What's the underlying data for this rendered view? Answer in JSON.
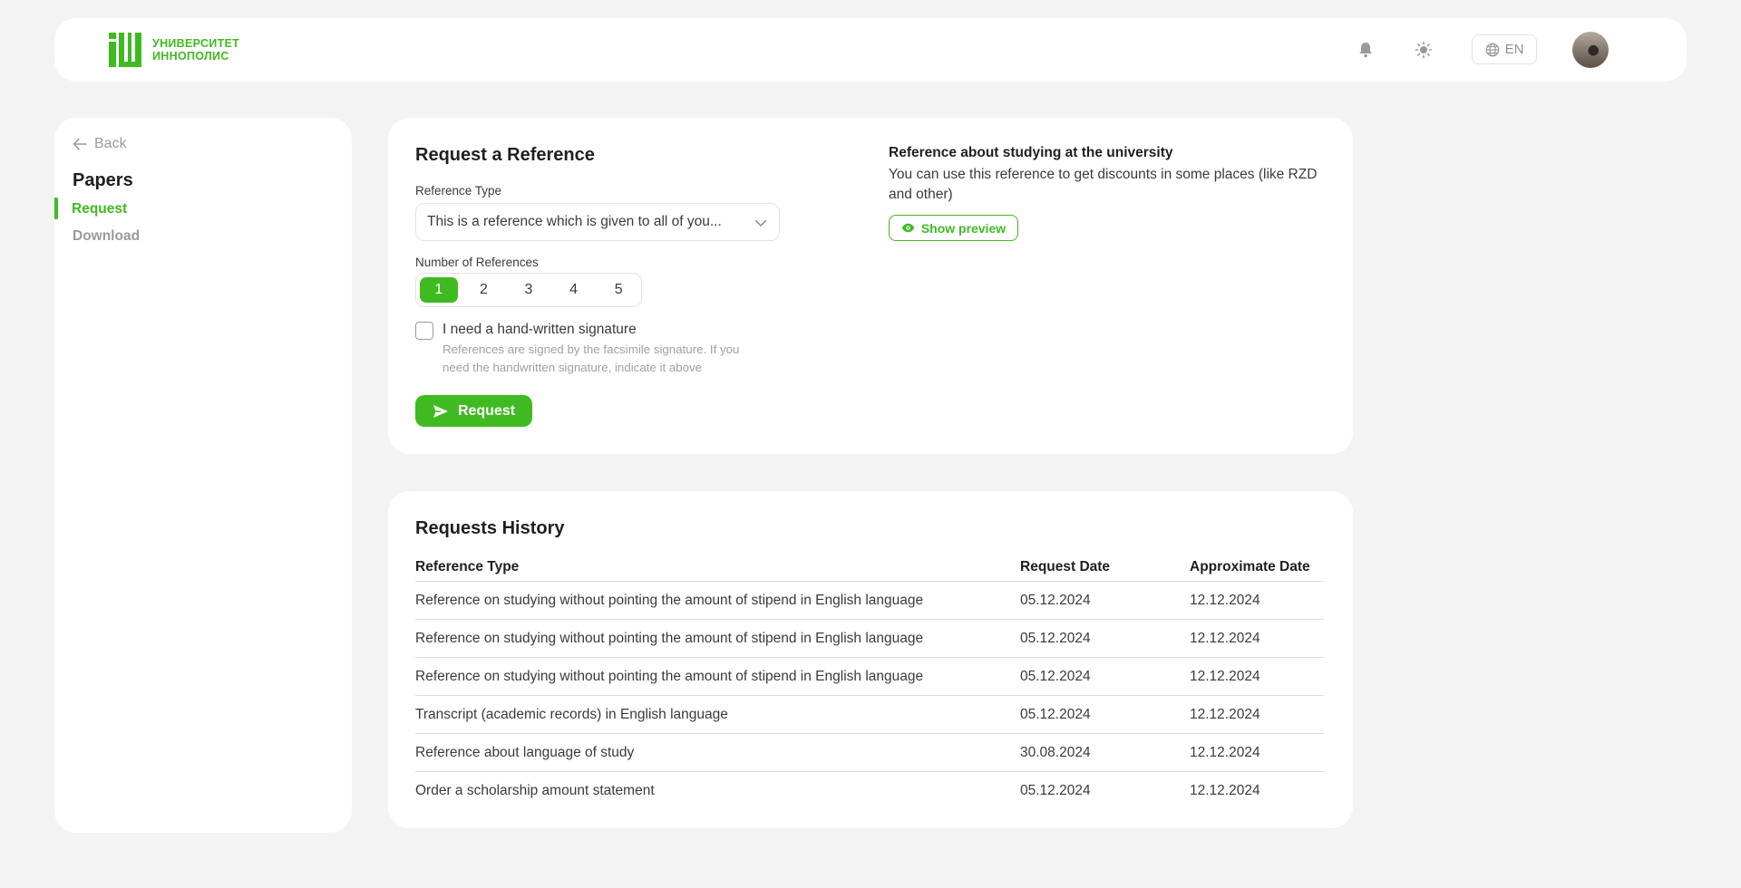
{
  "header": {
    "logo_line1": "УНИВЕРСИТЕТ",
    "logo_line2": "ИННОПОЛИС",
    "lang": "EN",
    "icons": [
      "bell-icon",
      "sun-icon",
      "globe-icon"
    ],
    "accent_color": "#40ba21"
  },
  "sidebar": {
    "back_label": "Back",
    "title": "Papers",
    "items": [
      {
        "label": "Request",
        "active": true
      },
      {
        "label": "Download",
        "active": false
      }
    ]
  },
  "request_form": {
    "title": "Request a Reference",
    "type_label": "Reference Type",
    "type_value": "This is a reference which is given to all of you...",
    "count_label": "Number of References",
    "counts": [
      "1",
      "2",
      "3",
      "4",
      "5"
    ],
    "selected_count": "1",
    "signature_label": "I need a hand-written signature",
    "signature_help": "References are signed by the facsimile signature. If you need the handwritten signature, indicate it above",
    "submit_label": "Request"
  },
  "info": {
    "title": "Reference about studying at the university",
    "description": "You can use this reference to get discounts in some places (like RZD and other)",
    "preview_label": "Show preview"
  },
  "history": {
    "title": "Requests History",
    "columns": [
      "Reference Type",
      "Request Date",
      "Approximate Date"
    ],
    "rows": [
      [
        "Reference on studying without pointing the amount of stipend in English language",
        "05.12.2024",
        "12.12.2024"
      ],
      [
        "Reference on studying without pointing the amount of stipend in English language",
        "05.12.2024",
        "12.12.2024"
      ],
      [
        "Reference on studying without pointing the amount of stipend in English language",
        "05.12.2024",
        "12.12.2024"
      ],
      [
        "Transcript (academic records) in English language",
        "05.12.2024",
        "12.12.2024"
      ],
      [
        "Reference about language of study",
        "30.08.2024",
        "12.12.2024"
      ],
      [
        "Order a scholarship amount statement",
        "05.12.2024",
        "12.12.2024"
      ]
    ]
  }
}
